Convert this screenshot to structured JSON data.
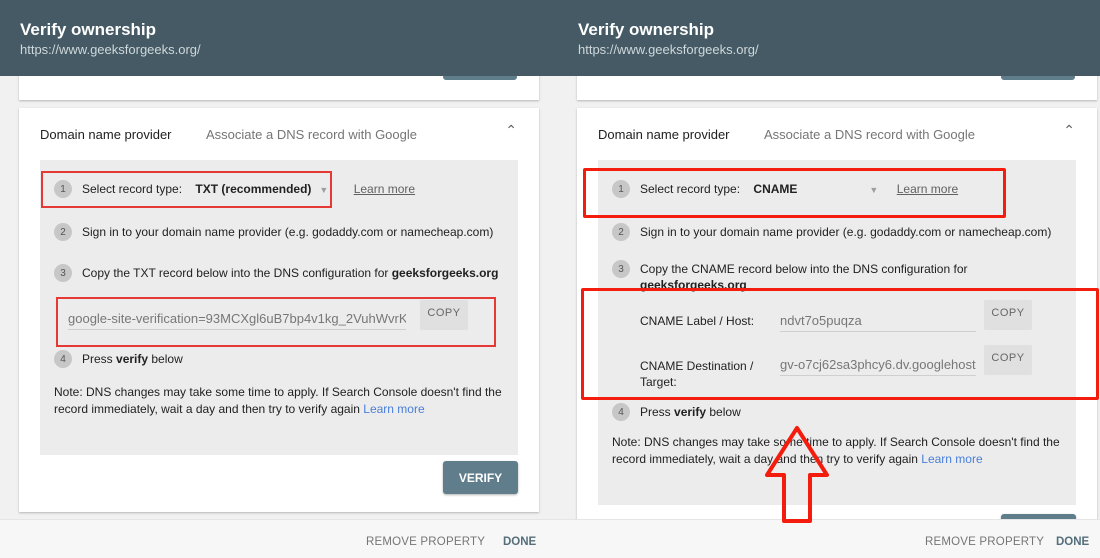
{
  "app": {
    "title": "Verify ownership",
    "url": "https://www.geeksforgeeks.org/"
  },
  "colors": {
    "header_bg": "#455a64",
    "primary_button": "#607d8b",
    "highlight": "#e53935",
    "link_blue": "#4a7fd8"
  },
  "left": {
    "card": {
      "label": "Domain name provider",
      "subtitle": "Associate a DNS record with Google",
      "chevron_icon": "chevron-up-icon"
    },
    "steps": {
      "s1": {
        "num": "1",
        "text": "Select record type:",
        "value": "TXT (recommended)",
        "learn_more": "Learn more"
      },
      "s2": {
        "num": "2",
        "text": "Sign in to your domain name provider (e.g. godaddy.com or namecheap.com)"
      },
      "s3": {
        "num": "3",
        "text": "Copy the TXT record below into the DNS configuration for ",
        "bold": "geeksforgeeks.org"
      },
      "s4": {
        "num": "4",
        "pre": "Press ",
        "bold": "verify",
        "post": " below"
      }
    },
    "txt_record": {
      "value": "google-site-verification=93MCXgl6uB7bp4v1kg_2VuhWvrK",
      "copy_label": "COPY"
    },
    "note": {
      "text": "Note: DNS changes may take some time to apply. If Search Console doesn't find the record immediately, wait a day and then try to verify again ",
      "link": "Learn more"
    },
    "verify_label": "VERIFY"
  },
  "right": {
    "card": {
      "label": "Domain name provider",
      "subtitle": "Associate a DNS record with Google",
      "chevron_icon": "chevron-up-icon"
    },
    "steps": {
      "s1": {
        "num": "1",
        "text": "Select record type:",
        "value": "CNAME",
        "learn_more": "Learn more"
      },
      "s2": {
        "num": "2",
        "text": "Sign in to your domain name provider (e.g. godaddy.com or namecheap.com)"
      },
      "s3": {
        "num": "3",
        "text": "Copy the CNAME record below into the DNS configuration for",
        "bold": "geeksforgeeks.org"
      },
      "s4": {
        "num": "4",
        "pre": "Press ",
        "bold": "verify",
        "post": " below"
      }
    },
    "cname_fields": [
      {
        "label": "CNAME Label / Host:",
        "value": "ndvt7o5puqza",
        "copy_label": "COPY"
      },
      {
        "label_line1": "CNAME Destination /",
        "label_line2": "Target:",
        "value": "gv-o7cj62sa3phcy6.dv.googlehost",
        "copy_label": "COPY"
      }
    ],
    "note": {
      "text": "Note: DNS changes may take some time to apply. If Search Console doesn't find the record immediately, wait a day and then try to verify again ",
      "link": "Learn more"
    }
  },
  "footer": {
    "remove_label": "REMOVE PROPERTY",
    "done_label": "DONE"
  }
}
